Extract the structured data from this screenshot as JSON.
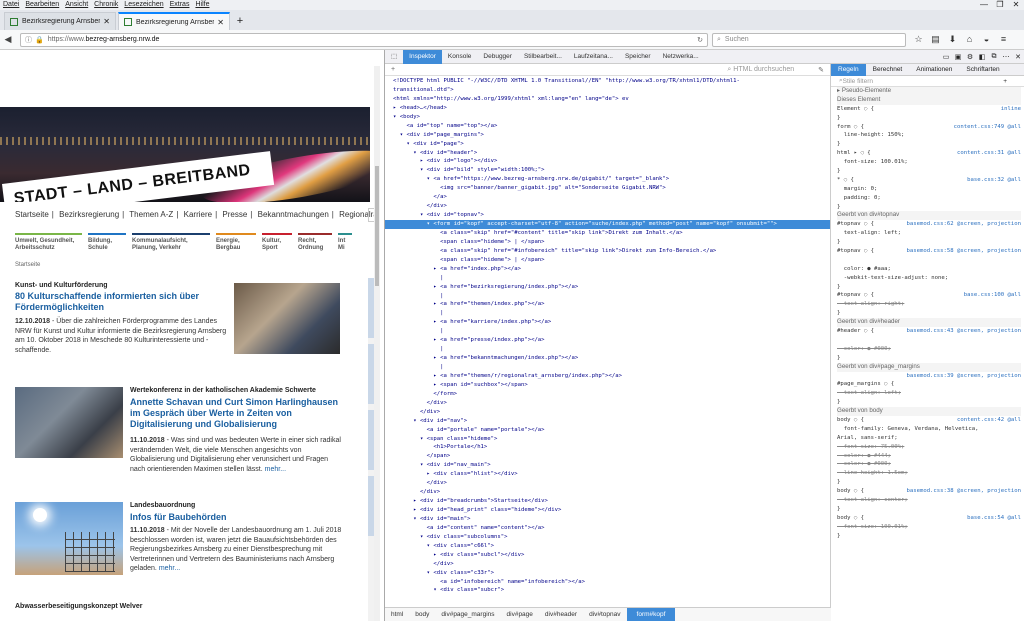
{
  "menubar": [
    "Datei",
    "Bearbeiten",
    "Ansicht",
    "Chronik",
    "Lesezeichen",
    "Extras",
    "Hilfe"
  ],
  "window_controls": [
    "—",
    "❐",
    "✕"
  ],
  "tabs": [
    {
      "label": "Bezirksregierung Arnsberg | Bez...",
      "active": false
    },
    {
      "label": "Bezirksregierung Arnsberg | Be...",
      "active": true
    }
  ],
  "nav": {
    "url_prefix": "https://www.",
    "url_host": "bezreg-arnsberg.nrw.de",
    "search_placeholder": "Suchen"
  },
  "site": {
    "hero_text": "STADT – LAND – BREITBAND",
    "topnav": [
      "Startseite",
      "|",
      "Bezirksregierung",
      "|",
      "Themen A-Z",
      "|",
      "Karriere",
      "|",
      "Presse",
      "|",
      "Bekanntmachungen",
      "|",
      "Regionalrat"
    ],
    "categories": [
      {
        "label": "Umwelt, Gesundheit, Arbeitsschutz",
        "color": "#7ab648"
      },
      {
        "label": "Bildung, Schule",
        "color": "#1f74c4"
      },
      {
        "label": "Kommunalaufsicht, Planung, Verkehr",
        "color": "#1b3f6e"
      },
      {
        "label": "Energie, Bergbau",
        "color": "#e08a1e"
      },
      {
        "label": "Kultur, Sport",
        "color": "#c8202e"
      },
      {
        "label": "Recht, Ordnung",
        "color": "#9a2b2b"
      },
      {
        "label": "Int Mi",
        "color": "#2c8f8f"
      }
    ],
    "breadcrumb": "Startseite",
    "articles": [
      {
        "label": "Kunst- und Kulturförderung",
        "head": "80 Kulturschaffende informierten sich über Fördermöglichkeiten",
        "date": "12.10.2018",
        "body": " - Über die zahlreichen Förderprogramme des Landes NRW für Kunst und Kultur informierte die Bezirksregierung Arnsberg am 10. Oktober 2018 in Meschede 80 Kulturinteressierte und -schaffende.",
        "more": "mehr..."
      },
      {
        "label": "Wertekonferenz in der katholischen Akademie Schwerte",
        "head": "Annette Schavan und Curt Simon Harlinghausen im Gespräch über Werte in Zeiten von Digitalisierung und Globalisierung",
        "date": "11.10.2018",
        "body": " - Was sind und was bedeuten Werte in einer sich radikal verändernden Welt, die viele Menschen angesichts von Globalisierung und Digitalisierung eher verunsichert und Fragen nach orientierenden Maximen stellen lässt.",
        "more": "mehr..."
      },
      {
        "label": "Landesbauordnung",
        "head": "Infos für Baubehörden",
        "date": "11.10.2018",
        "body": " - Mit der Novelle der Landesbauordnung am 1. Juli 2018 beschlossen worden ist, waren jetzt die Bauaufsichtsbehörden des Regierungsbezirkes Arnsberg zu einer Dienstbesprechung mit Vertreterinnen und Vertretern des Bauministeriums nach Arnsberg geladen.",
        "more": "mehr..."
      },
      {
        "label": "Abwasserbeseitigungskonzept Welver"
      }
    ]
  },
  "devtools": {
    "tabs": [
      "Inspektor",
      "Konsole",
      "Debugger",
      "Stilbearbeit...",
      "Laufzeitana...",
      "Speicher",
      "Netzwerka..."
    ],
    "html_search": "HTML durchsuchen",
    "markup_lines": [
      "<!DOCTYPE html PUBLIC \"-//W3C//DTD XHTML 1.0 Transitional//EN\" \"http://www.w3.org/TR/xhtml1/DTD/xhtml1-",
      "transitional.dtd\">",
      "<html xmlns=\"http://www.w3.org/1999/xhtml\" xml:lang=\"en\" lang=\"de\"> ev",
      "▸ <head>…</head>",
      "▾ <body>",
      "    <a id=\"top\" name=\"top\"></a>",
      "  ▾ <div id=\"page_margins\">",
      "    ▾ <div id=\"page\">",
      "      ▾ <div id=\"header\">",
      "        ▸ <div id=\"logo\"></div>",
      "        ▾ <div id=\"bild\" style=\"width:100%;\">",
      "          ▾ <a href=\"https://www.bezreg-arnsberg.nrw.de/gigabit/\" target=\"_blank\">",
      "              <img src=\"banner/banner_gigabit.jpg\" alt=\"Sonderseite Gigabit.NRW\">",
      "            </a>",
      "          </div>",
      "        ▾ <div id=\"topnav\">",
      "          ▾ <form id=\"kopf\" accept-charset=\"utf-8\" action=\"suche/index.php\" method=\"post\" name=\"kopf\" onsubmit=\"\">",
      "              <a class=\"skip\" href=\"#content\" title=\"skip link\">Direkt zum Inhalt.</a>",
      "              <span class=\"hideme\"> | </span>",
      "              <a class=\"skip\" href=\"#infobereich\" title=\"skip link\">Direkt zum Info-Bereich.</a>",
      "              <span class=\"hideme\"> | </span>",
      "            ▸ <a href=\"index.php\"></a>",
      "              |",
      "            ▸ <a href=\"bezirksregierung/index.php\"></a>",
      "              |",
      "            ▸ <a href=\"themen/index.php\"></a>",
      "              |",
      "            ▸ <a href=\"karriere/index.php\"></a>",
      "              |",
      "            ▸ <a href=\"presse/index.php\"></a>",
      "              |",
      "            ▸ <a href=\"bekanntmachungen/index.php\"></a>",
      "              |",
      "            ▸ <a href=\"themen/r/regionalrat_arnsberg/index.php\"></a>",
      "            ▸ <span id=\"suchbox\"></span>",
      "            </form>",
      "          </div>",
      "        </div>",
      "      ▾ <div id=\"nav\">",
      "          <a id=\"portale\" name=\"portale\"></a>",
      "        ▾ <span class=\"hideme\">",
      "            <h1>Portale</h1>",
      "          </span>",
      "        ▾ <div id=\"nav_main\">",
      "          ▸ <div class=\"hlist\"></div>",
      "          </div>",
      "        </div>",
      "      ▸ <div id=\"breadcrumbs\">Startseite</div>",
      "      ▸ <div id=\"head_print\" class=\"hideme\"></div>",
      "      ▾ <div id=\"main\">",
      "          <a id=\"content\" name=\"content\"></a>",
      "        ▾ <div class=\"subcolumns\">",
      "          ▾ <div class=\"c66l\">",
      "            ▸ <div class=\"subcl\"></div>",
      "            </div>",
      "          ▾ <div class=\"c33r\">",
      "              <a id=\"infobereich\" name=\"infobereich\"></a>",
      "            ▾ <div class=\"subcr\">"
    ],
    "breadcrumbs": [
      "html",
      "body",
      "div#page_margins",
      "div#page",
      "div#header",
      "div#topnav",
      "form#kopf"
    ],
    "rules_tabs": [
      "Regeln",
      "Berechnet",
      "Animationen",
      "Schriftarten"
    ],
    "filter": "Stile filtern",
    "rule_lines": [
      {
        "t": "▸ Pseudo-Elemente",
        "c": "hdr"
      },
      {
        "t": "Dieses Element",
        "c": "hdr"
      },
      {
        "t": "Element ◌ {",
        "s": "inline"
      },
      {
        "t": "}"
      },
      {
        "t": "form ◌ {",
        "s": "content.css:749 @all"
      },
      {
        "t": "  line-height: 150%;"
      },
      {
        "t": "}"
      },
      {
        "t": "html ▸ ◌ {",
        "s": "content.css:31 @all"
      },
      {
        "t": "  font-size: 100.01%;"
      },
      {
        "t": "}"
      },
      {
        "t": "* ◌ {",
        "s": "base.css:32 @all"
      },
      {
        "t": "  margin: 0;"
      },
      {
        "t": "  padding: 0;"
      },
      {
        "t": "}"
      },
      {
        "t": "Geerbt von div#topnav",
        "c": "hdr"
      },
      {
        "t": "#topnav ◌ {",
        "s": "basemod.css:62 @screen, projection"
      },
      {
        "t": "  text-align: left;"
      },
      {
        "t": "}"
      },
      {
        "t": "#topnav ◌ {",
        "s": "basemod.css:58 @screen, projection"
      },
      {
        "t": ""
      },
      {
        "t": "  color: ● #aaa;"
      },
      {
        "t": "  -webkit-text-size-adjust: none;"
      },
      {
        "t": "}"
      },
      {
        "t": "#topnav ◌ {",
        "s": "base.css:100 @all"
      },
      {
        "t": "  text-align: right;",
        "c": "strike"
      },
      {
        "t": "}"
      },
      {
        "t": "Geerbt von div#header",
        "c": "hdr"
      },
      {
        "t": "#header ◌ {",
        "s": "basemod.css:43 @screen, projection"
      },
      {
        "t": ""
      },
      {
        "t": "  color: ● #000;",
        "c": "strike"
      },
      {
        "t": "}"
      },
      {
        "t": "Geerbt von div#page_margins",
        "c": "hdr"
      },
      {
        "t": "",
        "s": "basemod.css:39 @screen, projection"
      },
      {
        "t": "#page_margins ◌ {"
      },
      {
        "t": "  text-align: left;",
        "c": "strike"
      },
      {
        "t": "}"
      },
      {
        "t": "Geerbt von body",
        "c": "hdr"
      },
      {
        "t": "body ◌ {",
        "s": "content.css:42 @all"
      },
      {
        "t": "  font-family: Geneva, Verdana, Helvetica,"
      },
      {
        "t": "Arial, sans-serif;"
      },
      {
        "t": "  font-size: 75.00%;",
        "c": "strike"
      },
      {
        "t": "  color: ● #444;",
        "c": "strike"
      },
      {
        "t": "  color: ● #000;",
        "c": "strike"
      },
      {
        "t": "  line-height: 1.5em;",
        "c": "strike"
      },
      {
        "t": "}"
      },
      {
        "t": "body ◌ {",
        "s": "basemod.css:38 @screen, projection"
      },
      {
        "t": "  text-align: center;",
        "c": "strike"
      },
      {
        "t": "}"
      },
      {
        "t": "body ◌ {",
        "s": "base.css:54 @all"
      },
      {
        "t": "  font-size: 100.01%;",
        "c": "strike"
      },
      {
        "t": "}"
      }
    ]
  },
  "colors": {
    "accent": "#3e8bd8",
    "link": "#1a5fa0"
  }
}
